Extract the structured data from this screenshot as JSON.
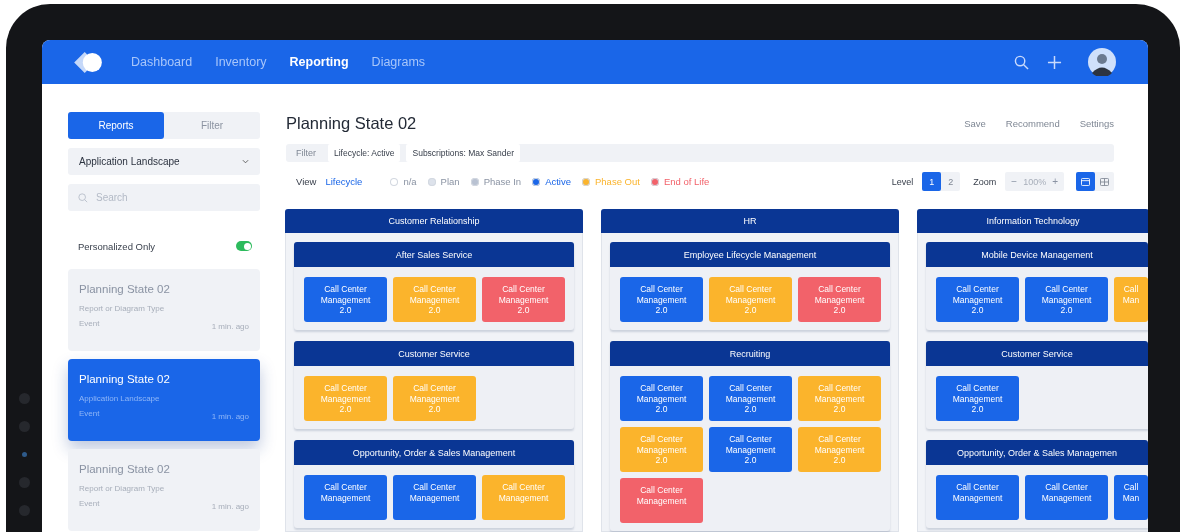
{
  "nav": {
    "items": [
      {
        "label": "Dashboard",
        "selected": false
      },
      {
        "label": "Inventory",
        "selected": false
      },
      {
        "label": "Reporting",
        "selected": true
      },
      {
        "label": "Diagrams",
        "selected": false
      }
    ]
  },
  "sidebar": {
    "tabs": [
      {
        "label": "Reports",
        "selected": true
      },
      {
        "label": "Filter",
        "selected": false
      }
    ],
    "dropdown": {
      "value": "Application Landscape"
    },
    "search": {
      "placeholder": "Search"
    },
    "personalized": {
      "label": "Personalized Only",
      "on": true
    },
    "reports": [
      {
        "title": "Planning State 02",
        "type": "Report or Diagram Type",
        "event": "Event",
        "time": "1 min. ago",
        "selected": false
      },
      {
        "title": "Planning State 02",
        "type": "Application Landscape",
        "event": "Event",
        "time": "1 min. ago",
        "selected": true
      },
      {
        "title": "Planning State 02",
        "type": "Report or Diagram Type",
        "event": "Event",
        "time": "1 min. ago",
        "selected": false
      }
    ]
  },
  "main": {
    "title": "Planning State 02",
    "actions": [
      "Save",
      "Recommend",
      "Settings"
    ],
    "filter": {
      "label": "Filter",
      "chips": [
        "Lifecycle: Active",
        "Subscriptions: Max Sander"
      ]
    },
    "view": {
      "label": "View",
      "value": "Lifecycle"
    },
    "legend": [
      {
        "label": "n/a",
        "color": "#ffffff",
        "emphasis": false
      },
      {
        "label": "Plan",
        "color": "#dde2eb",
        "emphasis": false
      },
      {
        "label": "Phase In",
        "color": "#b9c2d2",
        "emphasis": false
      },
      {
        "label": "Active",
        "color": "#1a66e8",
        "emphasis": true
      },
      {
        "label": "Phase Out",
        "color": "#fbb42c",
        "emphasis": true
      },
      {
        "label": "End of Life",
        "color": "#f2626a",
        "emphasis": true
      }
    ],
    "level": {
      "label": "Level",
      "options": [
        {
          "label": "1",
          "selected": true
        },
        {
          "label": "2",
          "selected": false
        }
      ]
    },
    "zoom": {
      "label": "Zoom",
      "minus": "−",
      "value": "100%",
      "plus": "+"
    },
    "layout_toggle": [
      {
        "kind": "board",
        "selected": true
      },
      {
        "kind": "grid",
        "selected": false
      }
    ],
    "columns": [
      {
        "title": "Customer Relationship",
        "groups": [
          {
            "title": "After Sales Service",
            "cards": [
              {
                "lines": [
                  "Call Center",
                  "Management",
                  "2.0"
                ],
                "color": "#1a66e8"
              },
              {
                "lines": [
                  "Call Center",
                  "Management",
                  "2.0"
                ],
                "color": "#fbb42c"
              },
              {
                "lines": [
                  "Call Center",
                  "Management",
                  "2.0"
                ],
                "color": "#f2626a"
              }
            ]
          },
          {
            "title": "Customer Service",
            "cards": [
              {
                "lines": [
                  "Call Center",
                  "Management",
                  "2.0"
                ],
                "color": "#fbb42c"
              },
              {
                "lines": [
                  "Call Center",
                  "Management",
                  "2.0"
                ],
                "color": "#fbb42c"
              }
            ]
          },
          {
            "title": "Opportunity, Order & Sales Management",
            "cards": [
              {
                "lines": [
                  "Call Center",
                  "Management"
                ],
                "color": "#1a66e8"
              },
              {
                "lines": [
                  "Call Center",
                  "Management"
                ],
                "color": "#1a66e8"
              },
              {
                "lines": [
                  "Call Center",
                  "Management"
                ],
                "color": "#fbb42c"
              }
            ]
          }
        ]
      },
      {
        "title": "HR",
        "groups": [
          {
            "title": "Employee Lifecycle Management",
            "cards": [
              {
                "lines": [
                  "Call Center",
                  "Management",
                  "2.0"
                ],
                "color": "#1a66e8"
              },
              {
                "lines": [
                  "Call Center",
                  "Management",
                  "2.0"
                ],
                "color": "#fbb42c"
              },
              {
                "lines": [
                  "Call Center",
                  "Management",
                  "2.0"
                ],
                "color": "#f2626a"
              }
            ]
          },
          {
            "title": "Recruiting",
            "cards": [
              {
                "lines": [
                  "Call Center",
                  "Management",
                  "2.0"
                ],
                "color": "#1a66e8"
              },
              {
                "lines": [
                  "Call Center",
                  "Management",
                  "2.0"
                ],
                "color": "#1a66e8"
              },
              {
                "lines": [
                  "Call Center",
                  "Management",
                  "2.0"
                ],
                "color": "#fbb42c"
              },
              {
                "lines": [
                  "Call Center",
                  "Management",
                  "2.0"
                ],
                "color": "#fbb42c"
              },
              {
                "lines": [
                  "Call Center",
                  "Management",
                  "2.0"
                ],
                "color": "#1a66e8"
              },
              {
                "lines": [
                  "Call Center",
                  "Management",
                  "2.0"
                ],
                "color": "#fbb42c"
              },
              {
                "lines": [
                  "Call Center",
                  "Management"
                ],
                "color": "#f2626a"
              }
            ]
          }
        ]
      },
      {
        "title": "Information Technology",
        "groups": [
          {
            "title": "Mobile Device Management",
            "cards": [
              {
                "lines": [
                  "Call Center",
                  "Management",
                  "2.0"
                ],
                "color": "#1a66e8"
              },
              {
                "lines": [
                  "Call Center",
                  "Management",
                  "2.0"
                ],
                "color": "#1a66e8"
              },
              {
                "lines": [
                  "Call",
                  "Man"
                ],
                "color": "#fbb42c"
              }
            ]
          },
          {
            "title": "Customer Service",
            "cards": [
              {
                "lines": [
                  "Call Center",
                  "Management",
                  "2.0"
                ],
                "color": "#1a66e8"
              }
            ]
          },
          {
            "title": "Opportunity, Order & Sales Managemen",
            "cards": [
              {
                "lines": [
                  "Call Center",
                  "Management"
                ],
                "color": "#1a66e8"
              },
              {
                "lines": [
                  "Call Center",
                  "Management"
                ],
                "color": "#1a66e8"
              },
              {
                "lines": [
                  "Call",
                  "Man"
                ],
                "color": "#1a66e8"
              }
            ]
          }
        ]
      }
    ]
  }
}
